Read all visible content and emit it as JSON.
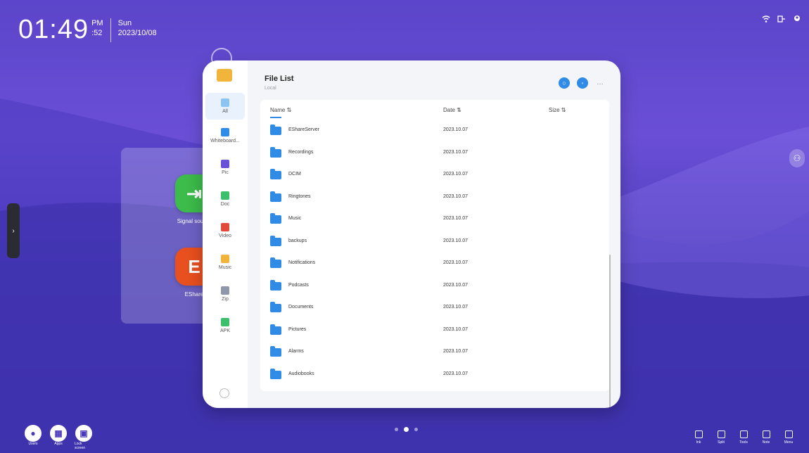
{
  "clock": {
    "time": "01:49",
    "ampm": "PM",
    "seconds": ":52",
    "weekday": "Sun",
    "date": "2023/10/08"
  },
  "status_icons": [
    "wifi-icon",
    "input-icon",
    "user-icon"
  ],
  "apps": [
    {
      "name": "Signal source",
      "color": "#3dbb4b",
      "icon": "⇥"
    },
    {
      "name": "EShare",
      "color": "#e8501f",
      "icon": "E"
    }
  ],
  "window": {
    "title": "File List",
    "subtitle": "Local",
    "sidebar": [
      {
        "label": "All",
        "color": "#8cc4f2",
        "active": true
      },
      {
        "label": "Whiteboard...",
        "color": "#2f8be6"
      },
      {
        "label": "Pic",
        "color": "#6a52d8"
      },
      {
        "label": "Doc",
        "color": "#3cbf6a"
      },
      {
        "label": "Video",
        "color": "#e24a3b"
      },
      {
        "label": "Music",
        "color": "#f2b53b"
      },
      {
        "label": "Zip",
        "color": "#8e98a8"
      },
      {
        "label": "APK",
        "color": "#3cbf6a"
      }
    ],
    "columns": {
      "name": "Name",
      "date": "Date",
      "size": "Size"
    },
    "rows": [
      {
        "name": "EShareServer",
        "date": "2023.10.07"
      },
      {
        "name": "Recordings",
        "date": "2023.10.07"
      },
      {
        "name": "DCIM",
        "date": "2023.10.07"
      },
      {
        "name": "Ringtones",
        "date": "2023.10.07"
      },
      {
        "name": "Music",
        "date": "2023.10.07"
      },
      {
        "name": "backups",
        "date": "2023.10.07"
      },
      {
        "name": "Notifications",
        "date": "2023.10.07"
      },
      {
        "name": "Podcasts",
        "date": "2023.10.07"
      },
      {
        "name": "Documents",
        "date": "2023.10.07"
      },
      {
        "name": "Pictures",
        "date": "2023.10.07"
      },
      {
        "name": "Alarms",
        "date": "2023.10.07"
      },
      {
        "name": "Audiobooks",
        "date": "2023.10.07"
      }
    ]
  },
  "bottom_left": [
    {
      "label": "Users",
      "icon": "👤"
    },
    {
      "label": "Apps",
      "icon": "⊞"
    },
    {
      "label": "Lock screen",
      "icon": "🔒"
    }
  ],
  "page_dots": 3,
  "page_active": 1,
  "bottom_right": [
    {
      "label": "Ink"
    },
    {
      "label": "Split"
    },
    {
      "label": "Tools"
    },
    {
      "label": "Note"
    },
    {
      "label": "Menu"
    }
  ]
}
